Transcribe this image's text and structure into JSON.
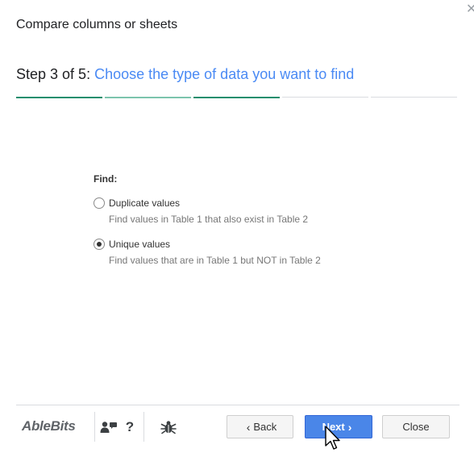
{
  "dialog": {
    "title": "Compare columns or sheets",
    "close_icon": "✕"
  },
  "step": {
    "prefix": "Step 3 of 5: ",
    "description": "Choose the type of data you want to find",
    "current": 3,
    "total": 5
  },
  "find": {
    "label": "Find:",
    "options": [
      {
        "label": "Duplicate values",
        "description": "Find values in Table 1 that also exist in Table 2",
        "selected": false
      },
      {
        "label": "Unique values",
        "description": "Find values that are in Table 1 but NOT in Table 2",
        "selected": true
      }
    ]
  },
  "footer": {
    "logo": "AbleBits",
    "icons": [
      "contacts-icon",
      "help-icon",
      "bug-report-icon"
    ],
    "help_glyph": "?",
    "back_label": "Back",
    "next_label": "Next",
    "close_label": "Close",
    "back_chevron": "‹",
    "next_chevron": "›"
  },
  "colors": {
    "accent_blue": "#4a8af4",
    "next_button": "#4a86e8",
    "progress_done": "#1e8e6e"
  }
}
